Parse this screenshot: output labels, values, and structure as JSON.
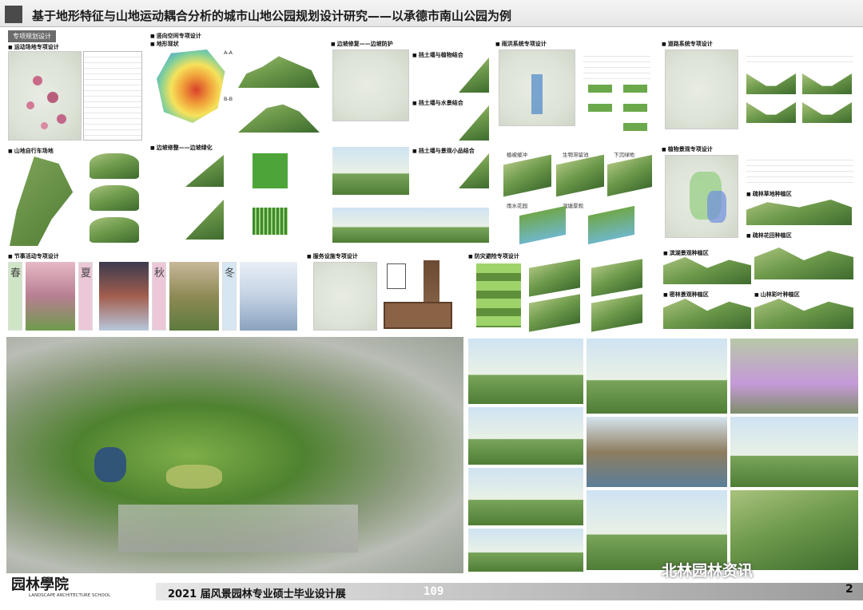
{
  "header": {
    "title": "基于地形特征与山地运动耦合分析的城市山地公园规划设计研究——以承德市南山公园为例"
  },
  "sections": {
    "special_plan_tab": "专项规划设计",
    "sports_site": "运动场地专项设计",
    "vertical_space": "竖向空间专项设计",
    "terrain": "地形现状",
    "section_a": "A-A",
    "section_b": "B-B",
    "slope_greening": "边坡修整——边坡绿化",
    "slope_repair": "边坡修复——边坡防护",
    "slope_label_1": "挡土墙与植物结合",
    "slope_label_2": "挡土墙与水景结合",
    "slope_label_3": "挡土墙与景观小品结合",
    "flood": "雨洪系统专项设计",
    "road": "道路系统专项设计",
    "plant": "植物景观专项设计",
    "bike": "山地自行车场地",
    "festival": "节事活动专项设计",
    "service": "服务设施专项设计",
    "disaster": "防灾避险专项设计",
    "plant_area_1": "疏林草地种植区",
    "plant_area_2": "疏林花田种植区",
    "plant_area_3": "滨湖景观种植区",
    "plant_area_4": "密林景观种植区",
    "plant_area_5": "山林彩叶种植区",
    "flood_cells": [
      "植被缓冲",
      "生物滞留池",
      "下沉绿地",
      "雨水花园",
      "湿塘景观"
    ]
  },
  "seasons": [
    "春",
    "夏",
    "秋",
    "冬"
  ],
  "footer": {
    "logo": "园林學院",
    "logo_sub": "LANDSCAPE ARCHITECTURE SCHOOL",
    "title": "2021 届风景园林专业硕士毕业设计展",
    "page": "109",
    "corner": "2",
    "watermark": "北林园林资讯"
  }
}
